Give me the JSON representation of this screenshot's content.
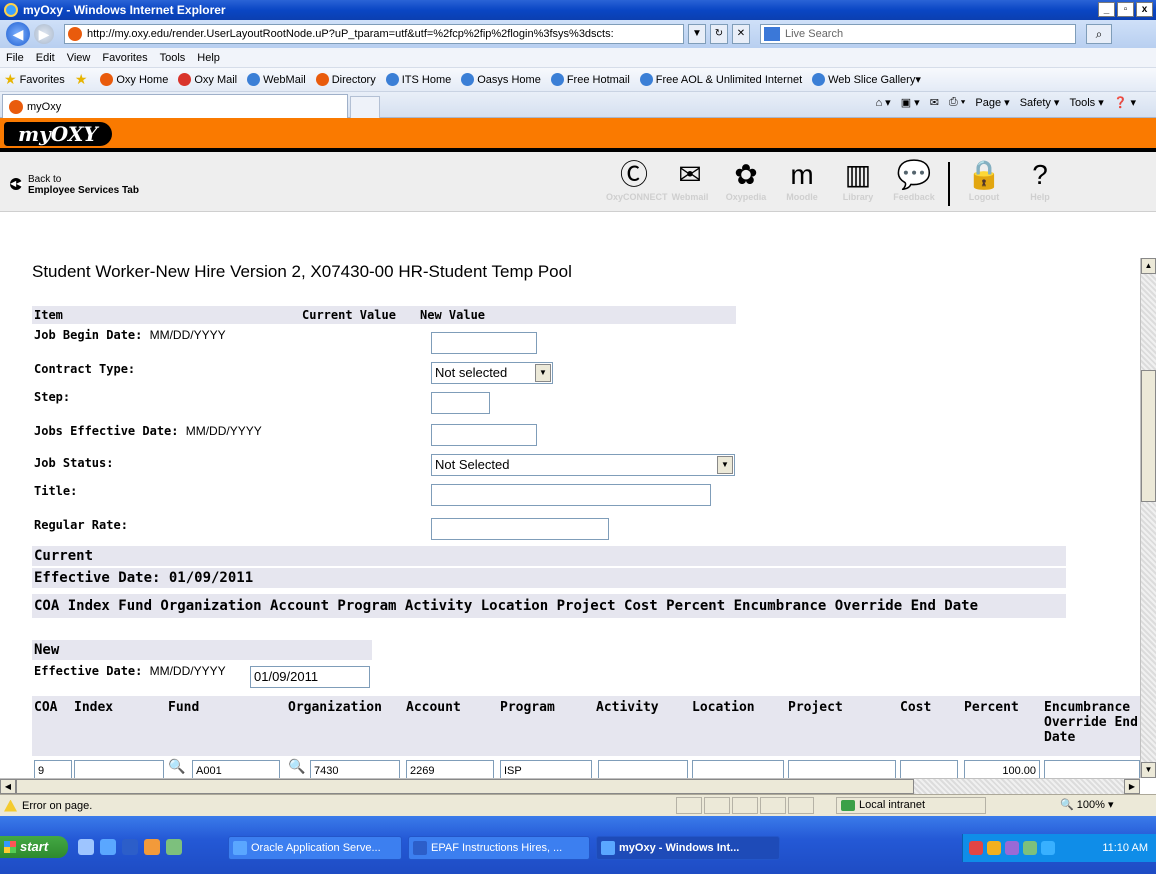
{
  "window": {
    "title": "myOxy - Windows Internet Explorer",
    "minimize": "_",
    "maximize": "▫",
    "close": "x"
  },
  "address": {
    "url": "http://my.oxy.edu/render.UserLayoutRootNode.uP?uP_tparam=utf&utf=%2fcp%2fip%2flogin%3fsys%3dscts:",
    "search_placeholder": "Live Search"
  },
  "menu": [
    "File",
    "Edit",
    "View",
    "Favorites",
    "Tools",
    "Help"
  ],
  "favorites": {
    "label": "Favorites",
    "items": [
      "Oxy Home",
      "Oxy Mail",
      "WebMail",
      "Directory",
      "ITS Home",
      "Oasys Home",
      "Free Hotmail",
      "Free AOL & Unlimited Internet",
      "Web Slice Gallery"
    ]
  },
  "tab": {
    "label": "myOxy"
  },
  "commands": [
    "Page",
    "Safety",
    "Tools"
  ],
  "banner": {
    "logo": "myOXY"
  },
  "oxynav": {
    "back_line1": "Back to",
    "back_line2": "Employee Services Tab",
    "icons": [
      {
        "name": "OxyCONNECT",
        "glyph": "Ⓒ"
      },
      {
        "name": "Webmail",
        "glyph": "✉"
      },
      {
        "name": "Oxypedia",
        "glyph": "✿"
      },
      {
        "name": "Moodle",
        "glyph": "m"
      },
      {
        "name": "Library",
        "glyph": "▥"
      },
      {
        "name": "Feedback",
        "glyph": "💬"
      },
      {
        "name": "Logout",
        "glyph": "🔒"
      },
      {
        "name": "Help",
        "glyph": "?"
      }
    ]
  },
  "form": {
    "title": "Student Worker-New Hire Version 2, X07430-00 HR-Student Temp Pool",
    "headers": {
      "item": "Item",
      "current": "Current Value",
      "new": "New Value"
    },
    "fields": [
      {
        "label": "Job Begin Date:",
        "format": "MM/DD/YYYY",
        "value": ""
      },
      {
        "label": "Contract Type:",
        "value": "Not selected"
      },
      {
        "label": "Step:",
        "value": ""
      },
      {
        "label": "Jobs Effective Date:",
        "format": "MM/DD/YYYY",
        "value": ""
      },
      {
        "label": "Job Status:",
        "value": "Not Selected"
      },
      {
        "label": "Title:",
        "value": ""
      },
      {
        "label": "Regular Rate:",
        "value": ""
      }
    ],
    "current": {
      "heading": "Current",
      "effective_date": "Effective Date: 01/09/2011",
      "columns": "COA Index Fund Organization Account Program Activity Location Project Cost Percent Encumbrance Override End Date"
    },
    "new": {
      "heading": "New",
      "effective_label": "Effective Date:",
      "effective_format": "MM/DD/YYYY",
      "effective_value": "01/09/2011",
      "columns": [
        "COA",
        "Index",
        "Fund",
        "Organization",
        "Account",
        "Program",
        "Activity",
        "Location",
        "Project",
        "Cost",
        "Percent",
        "Encumbrance Override End Date"
      ],
      "row": {
        "coa": "9",
        "index": "",
        "fund": "A001",
        "organization": "7430",
        "account": "2269",
        "program": "ISP",
        "activity": "",
        "location": "",
        "project": "",
        "cost": "",
        "percent": "100.00",
        "encumbrance": ""
      }
    }
  },
  "status": {
    "message": "Error on page.",
    "zone": "Local intranet",
    "zoom": "100%"
  },
  "taskbar": {
    "start": "start",
    "items": [
      "Oracle Application Serve...",
      "EPAF Instructions Hires, ...",
      "myOxy - Windows Int..."
    ],
    "clock": "11:10 AM"
  }
}
